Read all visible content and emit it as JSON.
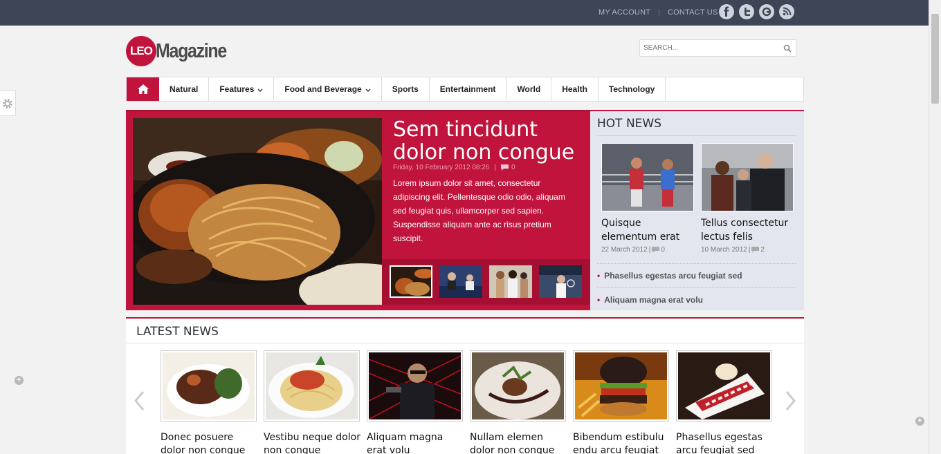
{
  "topbar": {
    "my_account": "MY ACCOUNT",
    "contact_us": "CONTACT US"
  },
  "logo": {
    "mark": "LEO",
    "name": "Magazine"
  },
  "search": {
    "placeholder": "SEARCH..."
  },
  "nav": {
    "items": [
      "Natural",
      "Features",
      "Food and Beverage",
      "Sports",
      "Entertainment",
      "World",
      "Health",
      "Technology"
    ]
  },
  "hero": {
    "title": "Sem tincidunt dolor non congue",
    "date": "Friday, 10 February 2012 08:26",
    "comments": "0",
    "body": "Lorem ipsum dolor sit amet, consectetur adipiscing elit. Pellentesque odio odio, aliquam sed feugiat quis, ullamcorper sed sapien. Suspendisse aliquam ante ac risus pretium suscipit."
  },
  "hot_news": {
    "title": "HOT NEWS",
    "cards": [
      {
        "headline": "Quisque elementum erat",
        "date": "22 March 2012",
        "comments": "0"
      },
      {
        "headline": "Tellus consectetur lectus felis",
        "date": "10 March 2012",
        "comments": "2"
      }
    ],
    "list": [
      "Phasellus egestas arcu feugiat sed",
      "Aliquam magna erat volu"
    ]
  },
  "latest_news": {
    "title": "LATEST NEWS",
    "items": [
      "Donec posuere dolor non congue",
      "Vestibu neque dolor non congue",
      "Aliquam magna erat volu",
      "Nullam elemen dolor non congue",
      "Bibendum estibulu endu arcu feugiat",
      "Phasellus egestas arcu feugiat sed"
    ]
  },
  "colors": {
    "brand": "#c0143c",
    "topbar": "#3d4556",
    "hot_bg": "#e3e6ee"
  }
}
